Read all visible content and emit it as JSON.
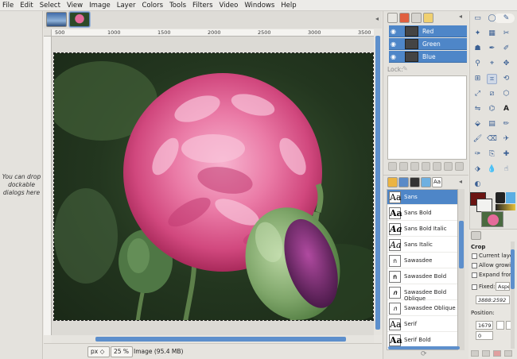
{
  "menu": [
    "File",
    "Edit",
    "Select",
    "View",
    "Image",
    "Layer",
    "Colors",
    "Tools",
    "Filters",
    "Video",
    "Windows",
    "Help"
  ],
  "left_dock": {
    "hint": "You can drop dockable dialogs here"
  },
  "ruler": {
    "ticks": [
      "500",
      "1000",
      "1500",
      "2000",
      "2500",
      "3000",
      "3500"
    ]
  },
  "status": {
    "unit": "px",
    "zoom": "25 %",
    "image_info": "Image (95.4 MB)"
  },
  "channels": {
    "rows": [
      "Red",
      "Green",
      "Blue"
    ],
    "lock_label": "Lock:"
  },
  "fonts": {
    "items": [
      "Sans",
      "Sans Bold",
      "Sans Bold Italic",
      "Sans Italic",
      "Sawasdee",
      "Sawasdee Bold",
      "Sawasdee Bold Oblique",
      "Sawasdee Oblique",
      "Serif",
      "Serif Bold"
    ],
    "glyph": "Aa"
  },
  "tool_options": {
    "title": "Crop",
    "current_layer": "Current laye",
    "allow_growing": "Allow growin",
    "expand_from": "Expand from",
    "fixed": "Fixed:",
    "fixed_mode": "Aspe",
    "ratio": "3888:2592",
    "position_label": "Position:",
    "position_value": "1679",
    "position_value2": "0"
  },
  "colors": {
    "foreground": "#6b1412",
    "background": "#f2f2f0",
    "selection": "#4e86c8"
  }
}
